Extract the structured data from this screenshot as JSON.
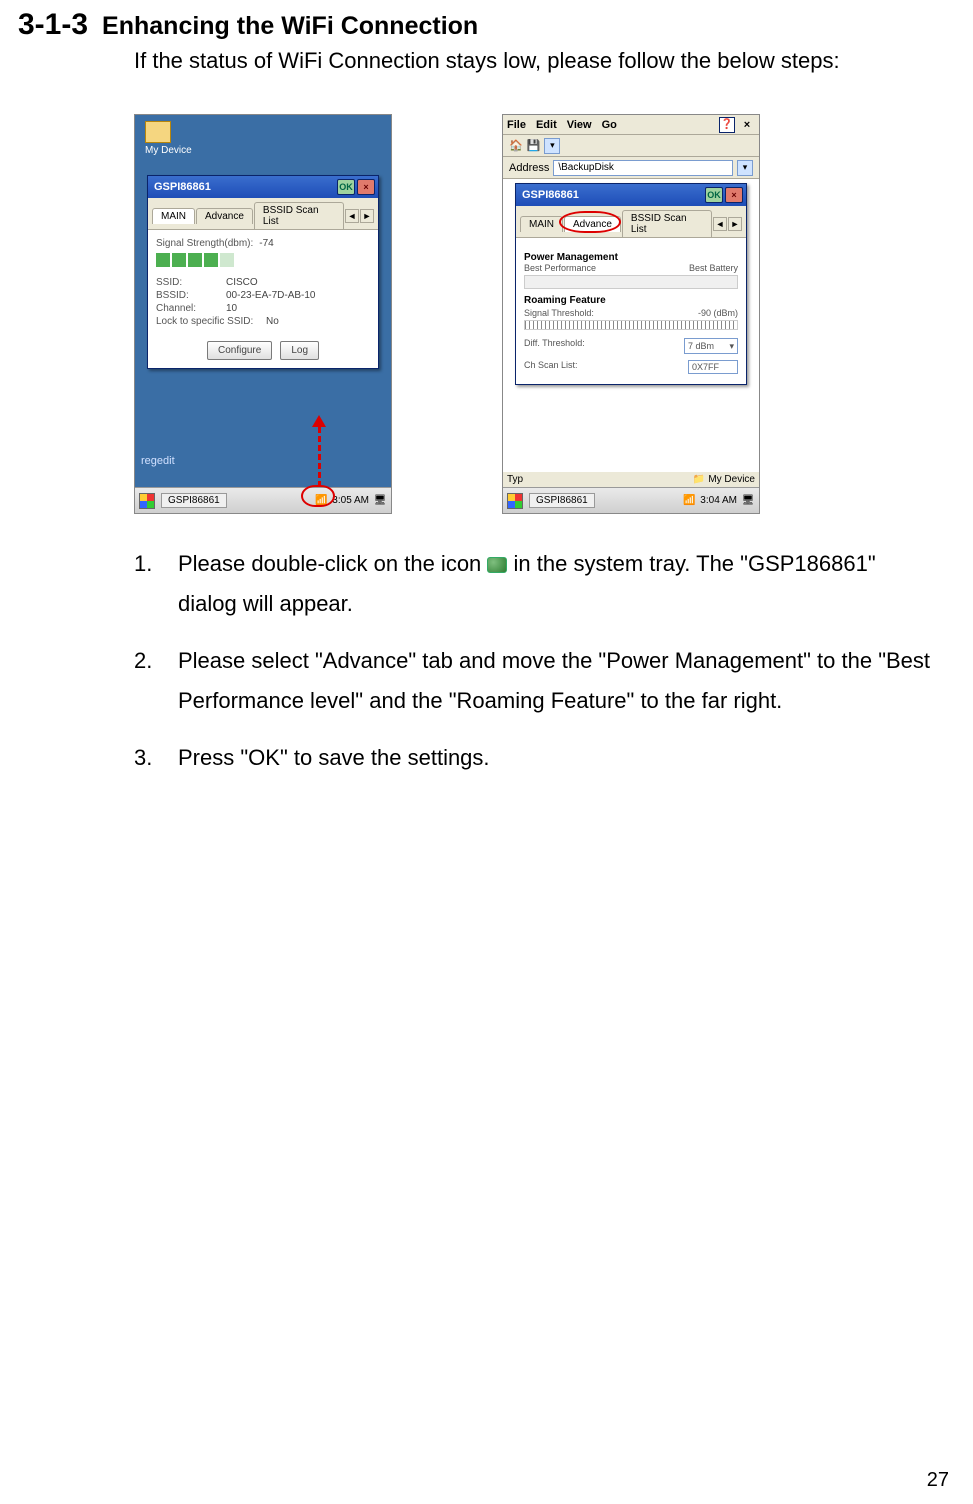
{
  "header": {
    "section_number": "3-1-3",
    "section_title": "Enhancing the WiFi Connection"
  },
  "intro": "If the status of WiFi Connection stays low, please follow the below steps:",
  "screenshot1": {
    "desktop_icon_label": "My Device",
    "regedit_label": "regedit",
    "dialog_title": "GSPI86861",
    "ok_button": "OK",
    "close_button": "×",
    "tabs": {
      "main": "MAIN",
      "advance": "Advance",
      "bssid": "BSSID Scan List",
      "arrow_left": "◄",
      "arrow_right": "►"
    },
    "signal_label": "Signal Strength(dbm):",
    "signal_value": "-74",
    "info": {
      "ssid_k": "SSID:",
      "ssid_v": "CISCO",
      "bssid_k": "BSSID:",
      "bssid_v": "00-23-EA-7D-AB-10",
      "channel_k": "Channel:",
      "channel_v": "10",
      "lock_k": "Lock to specific SSID:",
      "lock_v": "No"
    },
    "buttons": {
      "configure": "Configure",
      "log": "Log"
    },
    "taskbar": {
      "app": "GSPI86861",
      "time": "3:05 AM"
    }
  },
  "screenshot2": {
    "menu": {
      "file": "File",
      "edit": "Edit",
      "view": "View",
      "go": "Go"
    },
    "help_icon": "❓",
    "close_icon": "×",
    "address_label": "Address",
    "address_value": "\\BackupDisk",
    "dialog_title": "GSPI86861",
    "ok_button": "OK",
    "close_button": "×",
    "tabs": {
      "main": "MAIN",
      "advance": "Advance",
      "bssid": "BSSID Scan List",
      "arrow_left": "◄",
      "arrow_right": "►"
    },
    "pm_header": "Power Management",
    "pm_left": "Best Performance",
    "pm_right": "Best Battery",
    "roam_header": "Roaming Feature",
    "roam_signal_k": "Signal Threshold:",
    "roam_signal_v": "-90 (dBm)",
    "diff_k": "Diff. Threshold:",
    "diff_v": "7 dBm",
    "scan_k": "Ch Scan List:",
    "scan_v": "0X7FF",
    "type_label": "Typ",
    "type_value": "My Device",
    "taskbar": {
      "app": "GSPI86861",
      "time": "3:04 AM"
    }
  },
  "steps": {
    "s1": "Please double-click on the icon ",
    "s1b": " in the system tray. The \"GSP186861\" dialog will appear.",
    "s2": "Please select \"Advance\" tab and move the \"Power Management\" to the \"Best Performance level\" and the \"Roaming Feature\" to the far right.",
    "s3": "Press \"OK\" to save the settings."
  },
  "page_number": "27"
}
